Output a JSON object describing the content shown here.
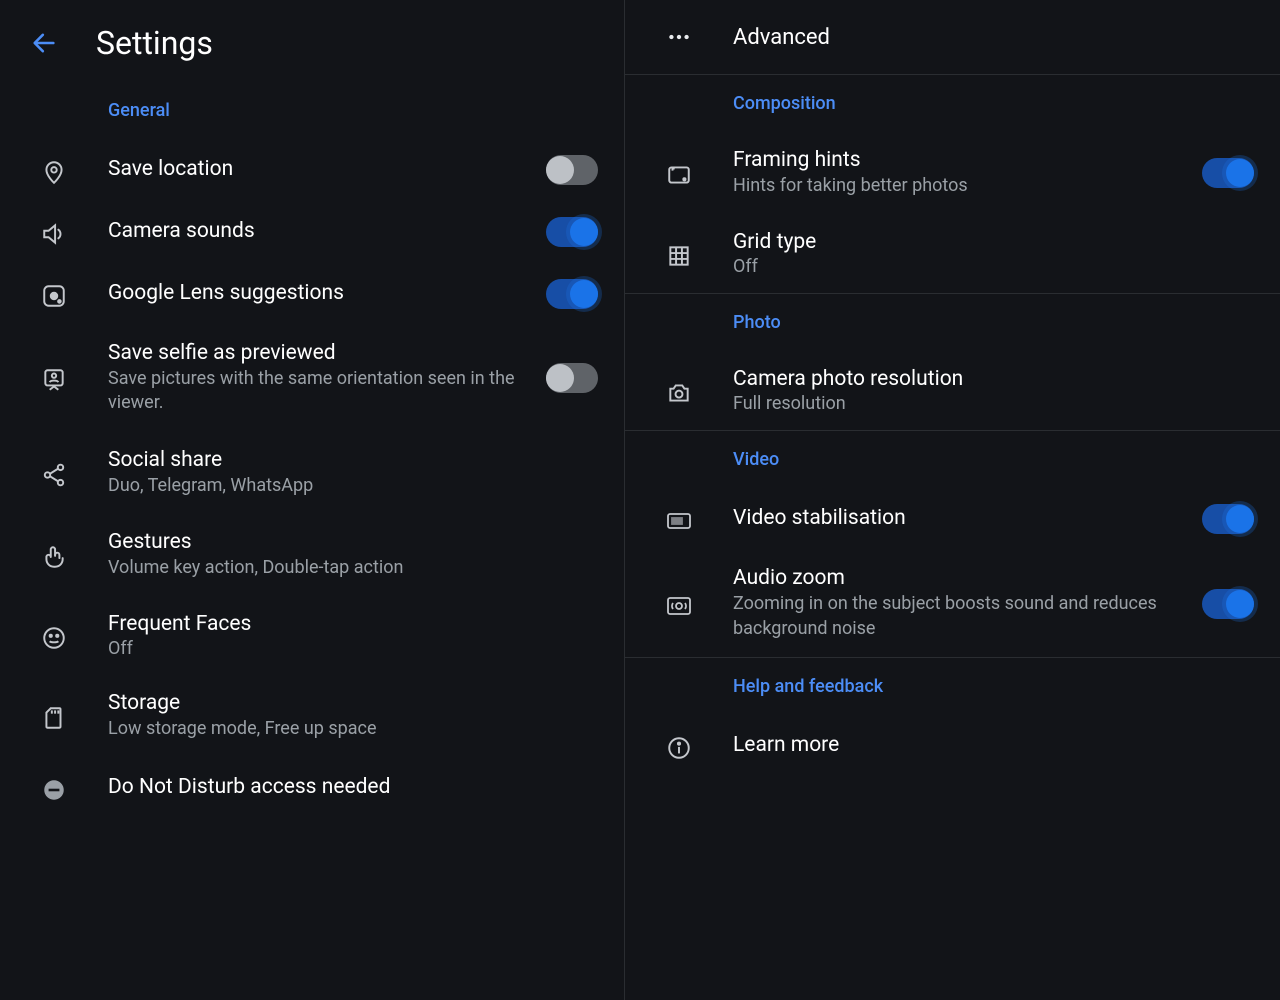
{
  "left": {
    "pageTitle": "Settings",
    "sections": {
      "general": "General"
    },
    "items": {
      "saveLocation": {
        "title": "Save location"
      },
      "cameraSounds": {
        "title": "Camera sounds"
      },
      "lens": {
        "title": "Google Lens suggestions"
      },
      "selfie": {
        "title": "Save selfie as previewed",
        "subtitle": "Save pictures with the same orientation seen in the viewer."
      },
      "socialShare": {
        "title": "Social share",
        "subtitle": "Duo, Telegram, WhatsApp"
      },
      "gestures": {
        "title": "Gestures",
        "subtitle": "Volume key action, Double-tap action"
      },
      "frequentFaces": {
        "title": "Frequent Faces",
        "value": "Off"
      },
      "storage": {
        "title": "Storage",
        "subtitle": "Low storage mode, Free up space"
      },
      "dnd": {
        "title": "Do Not Disturb access needed"
      }
    },
    "toggles": {
      "saveLocation": false,
      "cameraSounds": true,
      "lens": true,
      "selfie": false
    }
  },
  "right": {
    "advanced": "Advanced",
    "sections": {
      "composition": "Composition",
      "photo": "Photo",
      "video": "Video",
      "help": "Help and feedback"
    },
    "items": {
      "framing": {
        "title": "Framing hints",
        "subtitle": "Hints for taking better photos"
      },
      "gridType": {
        "title": "Grid type",
        "value": "Off"
      },
      "photoRes": {
        "title": "Camera photo resolution",
        "value": "Full resolution"
      },
      "stabilise": {
        "title": "Video stabilisation"
      },
      "audioZoom": {
        "title": "Audio zoom",
        "subtitle": "Zooming in on the subject boosts sound and reduces background noise"
      },
      "learnMore": {
        "title": "Learn more"
      }
    },
    "toggles": {
      "framing": true,
      "stabilise": true,
      "audioZoom": true
    }
  }
}
